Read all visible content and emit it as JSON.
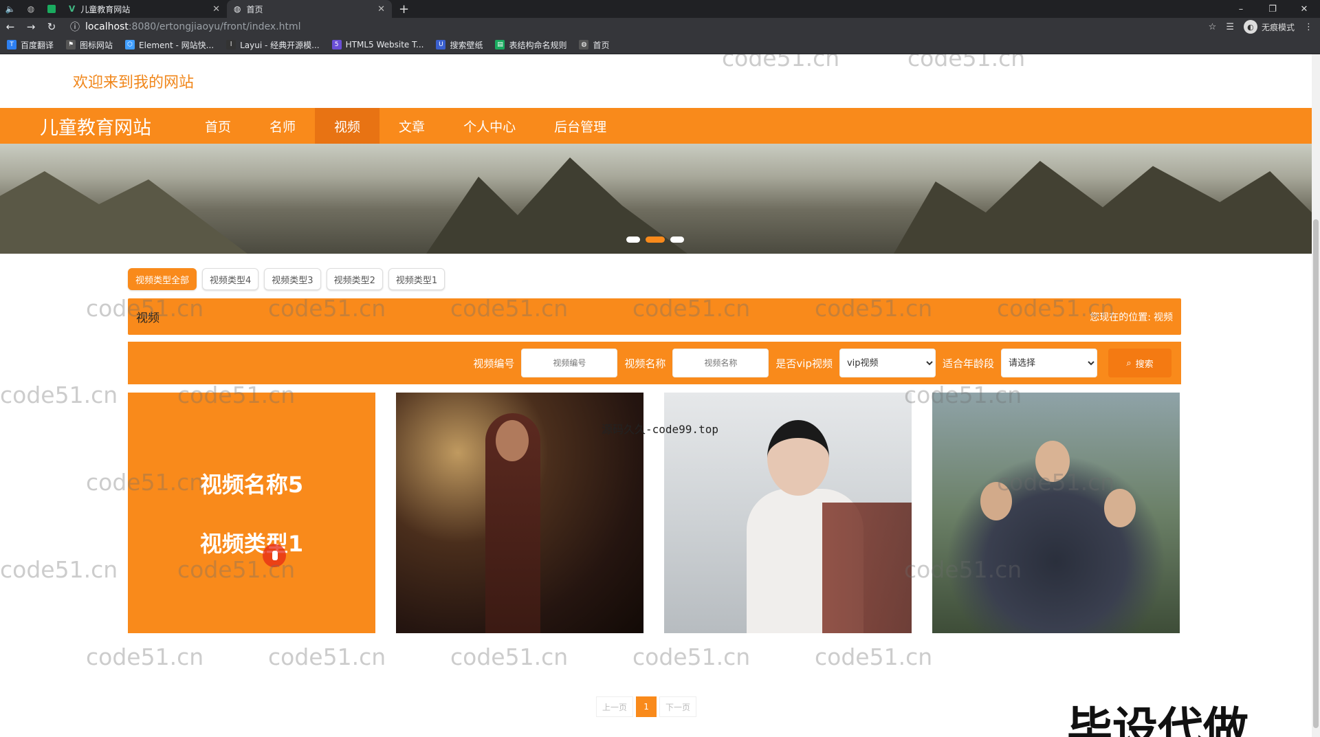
{
  "browser": {
    "tabs": [
      {
        "title": "儿童教育网站",
        "active": false
      },
      {
        "title": "首页",
        "active": true
      }
    ],
    "url_host": "localhost",
    "url_path": ":8080/ertongjiaoyu/front/index.html",
    "profile_label": "无痕模式",
    "bookmarks": [
      "百度翻译",
      "图标网站",
      "Element - 网站快...",
      "Layui - 经典开源模...",
      "HTML5 Website T...",
      "搜索壁纸",
      "表结构命名规则",
      "首页"
    ]
  },
  "site": {
    "welcome": "欢迎来到我的网站",
    "brand": "儿童教育网站",
    "nav": [
      "首页",
      "名师",
      "视频",
      "文章",
      "个人中心",
      "后台管理"
    ],
    "nav_active": "视频",
    "accent_color": "#f98a1b"
  },
  "type_tabs": [
    "视频类型全部",
    "视频类型4",
    "视频类型3",
    "视频类型2",
    "视频类型1"
  ],
  "breadcrumb": {
    "title": "视频",
    "location_label": "您现在的位置:",
    "location_value": "视频"
  },
  "search": {
    "code_label": "视频编号",
    "code_placeholder": "视频编号",
    "name_label": "视频名称",
    "name_placeholder": "视频名称",
    "vip_label": "是否vip视频",
    "vip_value": "vip视频",
    "age_label": "适合年龄段",
    "age_value": "请选择",
    "button_label": "搜索"
  },
  "cards": [
    {
      "name": "视频名称5",
      "type": "视频类型1",
      "hovered": true
    },
    {
      "name": "",
      "type": "",
      "hovered": false,
      "thumb": "woman-dark-room"
    },
    {
      "name": "",
      "type": "",
      "hovered": false,
      "thumb": "girl-white-dress"
    },
    {
      "name": "",
      "type": "",
      "hovered": false,
      "thumb": "group-of-men"
    }
  ],
  "pagination": {
    "prev_label": "上一页",
    "current": "1",
    "next_label": "下一页"
  },
  "overlays": {
    "watermark_text": "code51.cn",
    "source_text": "源码久久-code99.top",
    "corner_text": "毕设代做"
  }
}
